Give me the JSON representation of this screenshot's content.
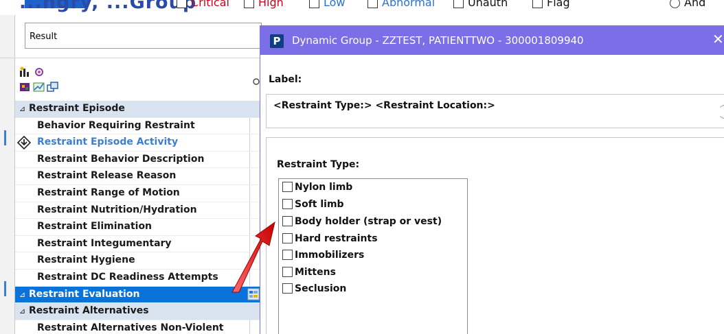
{
  "filter_bar": {
    "title_fragment": "...ngry, ...Group",
    "filters": [
      {
        "label": "Critical",
        "color": "#d0021b"
      },
      {
        "label": "High",
        "color": "#d0021b"
      },
      {
        "label": "Low",
        "color": "#2a6fd6"
      },
      {
        "label": "Abnormal",
        "color": "#2a6fd6"
      },
      {
        "label": "Unauth",
        "color": "#111111"
      },
      {
        "label": "Flag",
        "color": "#111111"
      }
    ],
    "and_label": "And"
  },
  "left_panel": {
    "result_text": "Result",
    "tree": {
      "groups": [
        {
          "label": "Restraint Episode"
        },
        {
          "label": "Restraint Evaluation"
        },
        {
          "label": "Restraint Alternatives"
        }
      ],
      "episode_items": [
        "Behavior Requiring Restraint",
        "Restraint Episode Activity",
        "Restraint Behavior Description",
        "Restraint Release Reason",
        "Restraint Range of Motion",
        "Restraint Nutrition/Hydration",
        "Restraint Elimination",
        "Restraint Integumentary",
        "Restraint Hygiene",
        "Restraint DC Readiness Attempts"
      ],
      "alternatives_items": [
        "Restraint Alternatives Non-Violent"
      ]
    }
  },
  "dialog": {
    "badge": "P",
    "title": "Dynamic Group - ZZTEST, PATIENTTWO - 300001809940",
    "close_glyph": "✕",
    "label_heading": "Label:",
    "label_value": "<Restraint Type:> <Restraint Location:>",
    "restraint_type_heading": "Restraint Type:",
    "restraint_types": [
      "Nylon limb",
      "Soft limb",
      "Body holder (strap or vest)",
      "Hard restraints",
      "Immobilizers",
      "Mittens",
      "Seclusion"
    ]
  },
  "colors": {
    "titlebar": "#7b6ee6",
    "selection": "#0a73d9",
    "group_header": "#d9e3f0",
    "link_text": "#3d7ed3",
    "annotation_arrow": "#e02020"
  }
}
